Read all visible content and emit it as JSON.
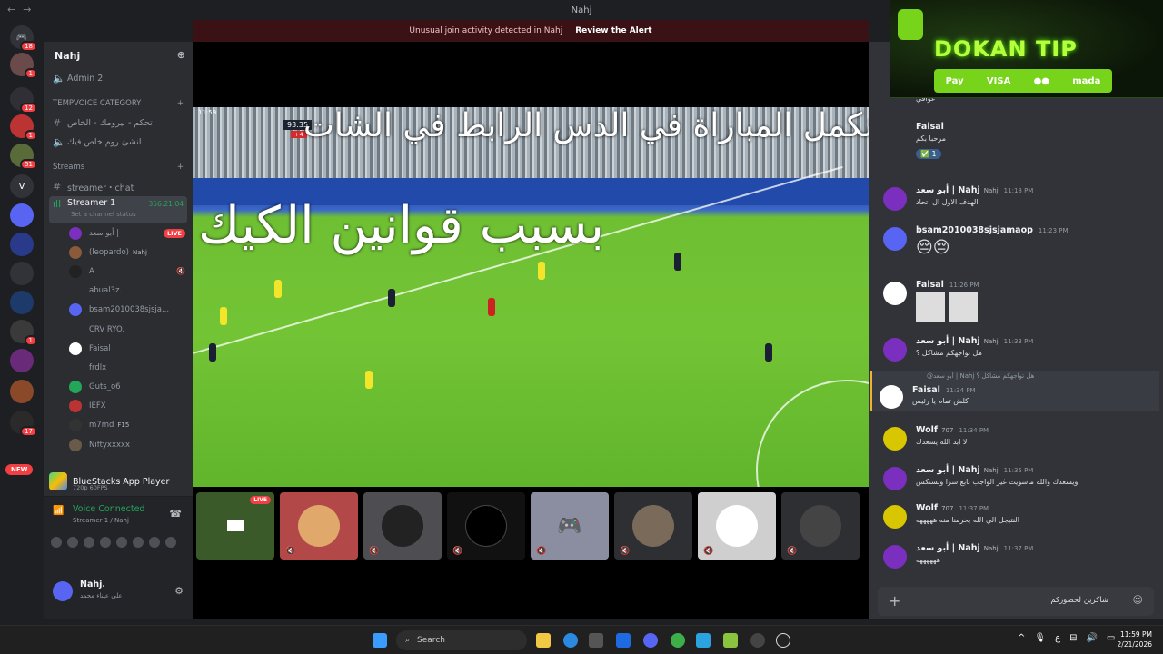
{
  "window": {
    "title": "Nahj"
  },
  "alert": {
    "text": "Unusual join activity detected in Nahj",
    "action": "Review the Alert"
  },
  "rail": {
    "badges": [
      "18",
      "1",
      "12",
      "1",
      "51",
      "1",
      "17",
      "17"
    ],
    "new_label": "NEW",
    "letter_server": "V"
  },
  "sidebar": {
    "server_name": "Nahj",
    "admin_channel": "Admin 2",
    "category1": "TEMPVOICE CATEGORY",
    "chan_text1": "تحكم - بيرومك - الخاص",
    "chan_voice1": "انشئ روم خاص فيك",
    "category2": "Streams",
    "chan_text2": "streamer・chat",
    "active_voice": "Streamer 1",
    "active_time": "356:21:04",
    "active_status": "Set a channel status",
    "users": [
      {
        "name": "أبو سعد |",
        "tag": "",
        "live": "LIVE"
      },
      {
        "name": "(leopardo)",
        "tag": "Nahj"
      },
      {
        "name": "A",
        "tag": ""
      },
      {
        "name": "abual3z.",
        "tag": ""
      },
      {
        "name": "bsam2010038sjsja...",
        "tag": ""
      },
      {
        "name": "CRV RYO.",
        "tag": ""
      },
      {
        "name": "Faisal",
        "tag": ""
      },
      {
        "name": "frdlx",
        "tag": ""
      },
      {
        "name": "Guts_o6",
        "tag": ""
      },
      {
        "name": "IEFX",
        "tag": ""
      },
      {
        "name": "m7md",
        "tag": "F15"
      },
      {
        "name": "Niftyxxxxx",
        "tag": ""
      }
    ],
    "app_name": "BlueStacks App Player",
    "app_sub": "720p 60FPS",
    "voice_connected": "Voice Connected",
    "voice_sub": "Streamer 1 / Nahj",
    "me_name": "Nahj.",
    "me_status": "على عيناء محمد"
  },
  "video": {
    "clock": "93:35",
    "added": "+4",
    "corner": "11:59",
    "overlay_line1": "حياكم الله نكمل المباراة في الدس الرابط في الشات",
    "overlay_line2": "بسبب قوانين الكيك",
    "tile_live": "LIVE"
  },
  "promo": {
    "brand": "DOKAN TIP",
    "pay": [
      "Pay",
      "VISA",
      "mada"
    ]
  },
  "chat": {
    "messages": [
      {
        "author": "",
        "time": "",
        "tag": "",
        "body": "عوافي"
      },
      {
        "author": "Faisal",
        "time": "",
        "tag": "",
        "body": "مرحبا بكم"
      },
      {
        "author": "أبو سعد | Nahj",
        "tag": "Nahj",
        "time": "11:18 PM",
        "body": "الهدف الاول ال اتحاد"
      },
      {
        "author": "bsam2010038sjsjamaop",
        "tag": "",
        "time": "11:23 PM",
        "body": "😔😔"
      },
      {
        "author": "Faisal",
        "tag": "",
        "time": "11:26 PM",
        "body": ""
      },
      {
        "author": "أبو سعد | Nahj",
        "tag": "Nahj",
        "time": "11:33 PM",
        "body": "هل تواجهكم مشاكل ؟"
      },
      {
        "author": "Faisal",
        "tag": "",
        "time": "11:34 PM",
        "body": "كلش تمام يا رئيس",
        "reply": "@أبو سعد | Nahj  هل تواجهكم مشاكل ؟"
      },
      {
        "author": "Wolf",
        "tag": "707",
        "time": "11:34 PM",
        "body": "لا ابد الله يسعدك"
      },
      {
        "author": "أبو سعد | Nahj",
        "tag": "Nahj",
        "time": "11:35 PM",
        "body": "ويسعدك والله ماسويت غير الواجب تابع سرا وتستكس"
      },
      {
        "author": "Wolf",
        "tag": "707",
        "time": "11:37 PM",
        "body": "النتيجل الي الله يحرمنا منه هههههه"
      },
      {
        "author": "أبو سعد | Nahj",
        "tag": "Nahj",
        "time": "11:37 PM",
        "body": "ههههههه"
      }
    ],
    "input_text": "شاكرين لحضوركم",
    "reaction": "1"
  },
  "taskbar": {
    "search": "Search",
    "time": "11:59 PM",
    "date": "2/21/2026"
  },
  "colors": {
    "accent": "#5865f2",
    "live": "#f23f43",
    "online": "#23a55a",
    "promo": "#77d41a"
  }
}
